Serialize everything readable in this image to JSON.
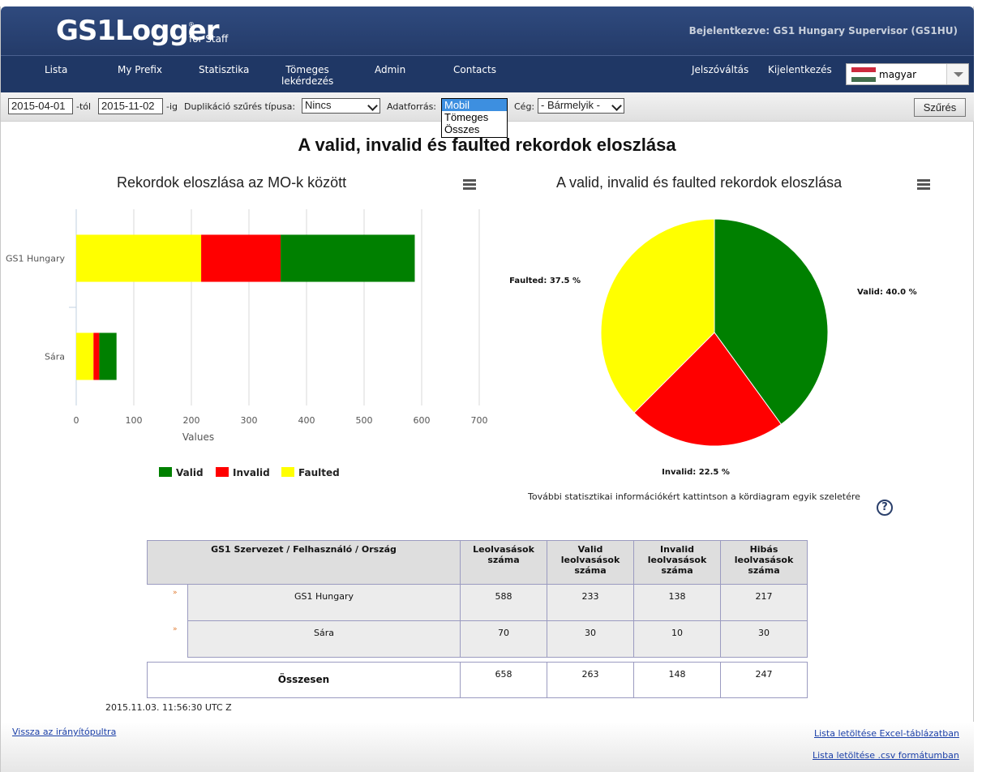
{
  "header": {
    "logo": "GS1Logger",
    "logo_sub": "for Staff",
    "logo_reg": "®",
    "login_info": "Bejelentkezve: GS1 Hungary Supervisor (GS1HU)"
  },
  "nav": {
    "items": [
      "Lista",
      "My Prefix",
      "Statisztika",
      "Tömeges",
      "lekérdezés",
      "Admin",
      "Contacts",
      "Jelszóváltás",
      "Kijelentkezés"
    ],
    "language": "magyar",
    "flag_colors": [
      "#cd2a3e",
      "#ffffff",
      "#436f4d"
    ]
  },
  "filter": {
    "date_from": "2015-04-01",
    "from_label": "-tól",
    "date_to": "2015-11-02",
    "to_label": "-ig",
    "dup_label": "Duplikáció szűrés típusa:",
    "dup_value": "Nincs",
    "source_label": "Adatforrás:",
    "source_options": [
      "Mobil",
      "Tömeges",
      "Összes"
    ],
    "company_label": "Cég:",
    "company_value": "- Bármelyik -",
    "button": "Szűrés"
  },
  "page_title": "A valid, invalid és faulted rekordok eloszlása",
  "chart_data": [
    {
      "type": "bar",
      "orientation": "horizontal",
      "stacked": true,
      "title": "Rekordok eloszlása az MO-k között",
      "categories": [
        "GS1 Hungary",
        "Sára"
      ],
      "series": [
        {
          "name": "Faulted",
          "color": "#ffff00",
          "values": [
            217,
            30
          ]
        },
        {
          "name": "Invalid",
          "color": "#ff0000",
          "values": [
            138,
            10
          ]
        },
        {
          "name": "Valid",
          "color": "#008000",
          "values": [
            233,
            30
          ]
        }
      ],
      "xlabel": "Values",
      "xlim": [
        0,
        700
      ],
      "ticks": [
        "0",
        "100",
        "200",
        "300",
        "400",
        "500",
        "600",
        "700"
      ],
      "grid": true,
      "legend": "bottom",
      "legend_order": [
        "Valid",
        "Invalid",
        "Faulted"
      ]
    },
    {
      "type": "pie",
      "title": "A valid, invalid és faulted rekordok eloszlása",
      "slices": [
        {
          "name": "Valid",
          "value": 40.0,
          "label": "Valid: 40.0 %",
          "color": "#008000"
        },
        {
          "name": "Invalid",
          "value": 22.5,
          "label": "Invalid: 22.5 %",
          "color": "#ff0000"
        },
        {
          "name": "Faulted",
          "value": 37.5,
          "label": "Faulted: 37.5 %",
          "color": "#ffff00"
        }
      ]
    }
  ],
  "pie_note": "További statisztikai információkért kattintson a kördiagram egyik szeletére",
  "help": "?",
  "table": {
    "headers": [
      "GS1 Szervezet / Felhasználó / Ország",
      "Leolvasások száma",
      "Valid leolvasások száma",
      "Invalid leolvasások száma",
      "Hibás leolvasások száma"
    ],
    "header_lines": [
      [
        "GS1 Szervezet / Felhasználó / Ország"
      ],
      [
        "Leolvasások",
        "száma"
      ],
      [
        "Valid",
        "leolvasások",
        "száma"
      ],
      [
        "Invalid",
        "leolvasások",
        "száma"
      ],
      [
        "Hibás",
        "leolvasások",
        "száma"
      ]
    ],
    "rows": [
      [
        "GS1 Hungary",
        "588",
        "233",
        "138",
        "217"
      ],
      [
        "Sára",
        "70",
        "30",
        "10",
        "30"
      ]
    ],
    "total": [
      "Összesen",
      "658",
      "263",
      "148",
      "247"
    ],
    "row_icon": "»"
  },
  "timestamp": "2015.11.03. 11:56:30 UTC Z",
  "links": {
    "back": "Vissza az irányítópultra",
    "excel": "Lista letöltése Excel-táblázatban",
    "csv": "Lista letöltése .csv formátumban"
  }
}
